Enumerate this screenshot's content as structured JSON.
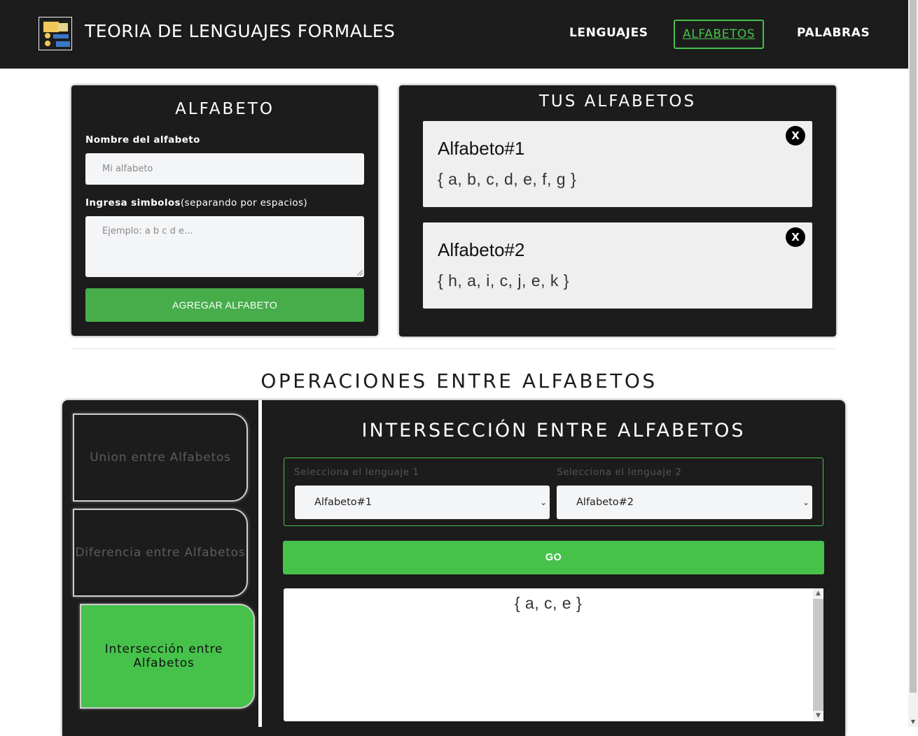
{
  "nav": {
    "brand": "TEORIA DE LENGUAJES FORMALES",
    "links": [
      "LENGUAJES",
      "ALFABETOS",
      "PALABRAS"
    ],
    "active": "ALFABETOS"
  },
  "alphabet_form": {
    "title": "ALFABETO",
    "name_label": "Nombre del alfabeto",
    "name_placeholder": "Mi alfabeto",
    "symbols_label": "Ingresa simbolos",
    "symbols_hint": "(separando por espacios)",
    "symbols_placeholder": "Ejemplo: a b c d e...",
    "submit": "AGREGAR ALFABETO"
  },
  "your_alphabets": {
    "title": "TUS ALFABETOS",
    "items": [
      {
        "name": "Alfabeto#1",
        "symbols": "{ a, b, c, d, e, f, g }",
        "close": "X"
      },
      {
        "name": "Alfabeto#2",
        "symbols": "{ h, a, i, c, j, e, k }",
        "close": "X"
      }
    ]
  },
  "operations": {
    "title": "OPERACIONES ENTRE ALFABETOS",
    "tabs": [
      "Union entre Alfabetos",
      "Diferencia entre Alfabetos",
      "Intersección entre Alfabetos"
    ],
    "active_tab": 2,
    "panel_title": "INTERSECCIÓN ENTRE ALFABETOS",
    "select1_label": "Selecciona el lenguaje 1",
    "select1_value": "Alfabeto#1",
    "select2_label": "Selecciona el lenguaje 2",
    "select2_value": "Alfabeto#2",
    "go": "GO",
    "result": "{ a, c, e }"
  },
  "colors": {
    "dark": "#1c1c1c",
    "accent_green": "#46c24b",
    "button_green": "#46ad4a"
  }
}
